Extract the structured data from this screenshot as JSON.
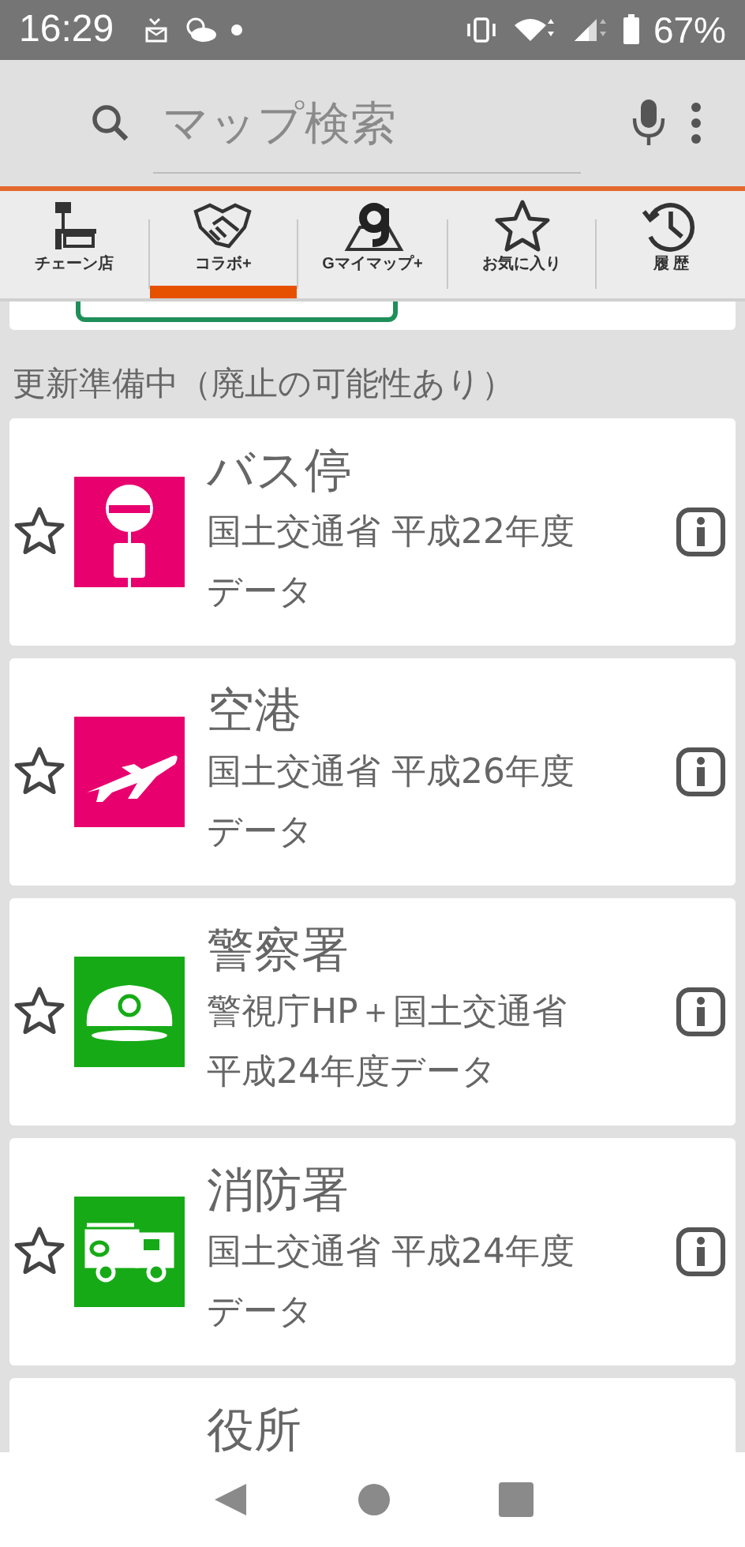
{
  "status_bar": {
    "time": "16:29",
    "battery": "67%"
  },
  "search": {
    "placeholder": "マップ検索"
  },
  "tabs": [
    {
      "label": "チェーン店",
      "kind": "chain",
      "selected": false
    },
    {
      "label": "コラボ+",
      "kind": "collab",
      "selected": true
    },
    {
      "label": "Gマイマップ+",
      "kind": "mymap",
      "selected": false
    },
    {
      "label": "お気に入り",
      "kind": "favorite",
      "selected": false
    },
    {
      "label": "履 歴",
      "kind": "history",
      "selected": false
    }
  ],
  "section": {
    "title": "更新準備中（廃止の可能性あり）"
  },
  "items": [
    {
      "title": "バス停",
      "kind": "bus_stop",
      "color": "#e8006e",
      "lines": [
        "国土交通省 平成22年度",
        "データ"
      ]
    },
    {
      "title": "空港",
      "kind": "airport",
      "color": "#e8006e",
      "lines": [
        "国土交通省 平成26年度",
        "データ"
      ]
    },
    {
      "title": "警察署",
      "kind": "police",
      "color": "#16ab16",
      "lines": [
        "警視庁HP＋国土交通省",
        "平成24年度データ"
      ]
    },
    {
      "title": "消防署",
      "kind": "fire",
      "color": "#16ab16",
      "lines": [
        "国土交通省 平成24年度",
        "データ"
      ]
    },
    {
      "title": "役所",
      "kind": "partial"
    }
  ]
}
